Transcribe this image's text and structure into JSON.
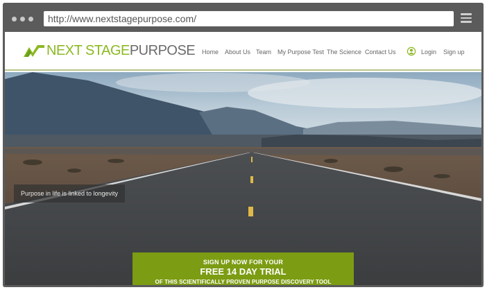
{
  "browser": {
    "url": "http://www.nextstagepurpose.com/",
    "window_dots": [
      "close",
      "minimize",
      "maximize"
    ],
    "menu_icon": "hamburger-icon"
  },
  "site": {
    "logo": {
      "part1": "NEXT STAGE",
      "part2": "PURPOSE",
      "mark_icon": "logo-chevron-icon"
    },
    "nav": {
      "home": "Home",
      "about": "About Us",
      "team": "Team",
      "test": "My Purpose Test",
      "science": "The Science",
      "contact": "Contact Us",
      "login": "Login",
      "signup": "Sign up"
    },
    "user_icon": "user-circle-icon"
  },
  "hero": {
    "caption": "Purpose in life is linked to longevity",
    "cta": {
      "line1": "SIGN UP NOW FOR YOUR",
      "line2": "FREE 14 DAY TRIAL",
      "line3": "OF THIS SCIENTIFICALLY PROVEN PURPOSE DISCOVERY TOOL"
    }
  },
  "colors": {
    "brand_green": "#8cb822",
    "cta_green": "#7c9c13",
    "chrome_gray": "#5b5b5b"
  }
}
